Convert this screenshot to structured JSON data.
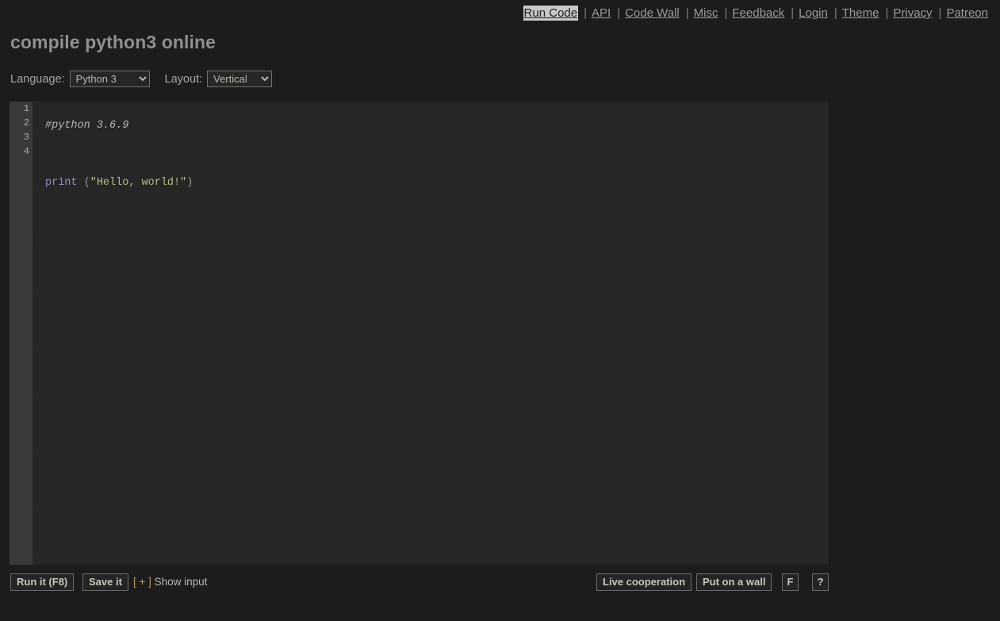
{
  "nav": {
    "separator": "|",
    "items": [
      {
        "label": "Run Code",
        "active": true
      },
      {
        "label": "API",
        "active": false
      },
      {
        "label": "Code Wall",
        "active": false
      },
      {
        "label": "Misc",
        "active": false
      },
      {
        "label": "Feedback",
        "active": false
      },
      {
        "label": "Login",
        "active": false
      },
      {
        "label": "Theme",
        "active": false
      },
      {
        "label": "Privacy",
        "active": false
      },
      {
        "label": "Patreon",
        "active": false
      }
    ]
  },
  "page": {
    "title": "compile python3 online"
  },
  "controls": {
    "language_label": "Language:",
    "language_value": "Python 3",
    "language_options": [
      "Python 3"
    ],
    "layout_label": "Layout:",
    "layout_value": "Vertical",
    "layout_options": [
      "Vertical"
    ]
  },
  "editor": {
    "line_numbers": [
      "1",
      "2",
      "3",
      "4"
    ],
    "lines": [
      {
        "text": "#python 3.6.9",
        "type": "comment"
      },
      {
        "text": "",
        "type": "blank"
      },
      {
        "text": "print (\"Hello, world!\")",
        "type": "code"
      },
      {
        "text": "",
        "type": "blank"
      }
    ],
    "code_tokens": {
      "comment": "#python 3.6.9",
      "keyword": "print",
      "open_paren": " (",
      "string": "\"Hello, world!\"",
      "close_paren": ")"
    }
  },
  "toolbar": {
    "run_label": "Run it (F8)",
    "save_label": "Save it",
    "show_input_plus": "[ + ]",
    "show_input_label": " Show input",
    "live_cooperation_label": "Live cooperation",
    "put_on_wall_label": "Put on a wall",
    "fullscreen_label": "F",
    "help_label": "?"
  },
  "colors": {
    "page_background": "#1c1c1c",
    "editor_background": "#262626",
    "gutter_background": "#3a3a3a",
    "link": "#9b9b9b",
    "active_link_background": "#c8c8c8",
    "comment": "#b6b6b6",
    "keyword": "#8f8fc4",
    "string": "#b9b987",
    "accent": "#b59a63"
  }
}
